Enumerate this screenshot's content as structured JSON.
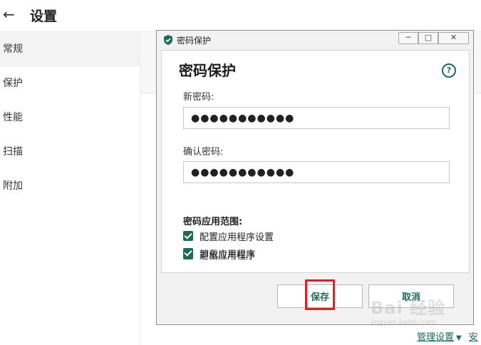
{
  "header": {
    "title": "设置",
    "back_glyph": "←"
  },
  "sidebar": {
    "items": [
      {
        "label": "常规",
        "active": true
      },
      {
        "label": "保护"
      },
      {
        "label": "性能"
      },
      {
        "label": "扫描"
      },
      {
        "label": "附加"
      }
    ]
  },
  "footer": {
    "manage_settings": "管理设置",
    "truncated_link": "安"
  },
  "dialog": {
    "caption": "密码保护",
    "heading": "密码保护",
    "help_glyph": "?",
    "new_password": {
      "label": "新密码:",
      "value": "●●●●●●●●●●●"
    },
    "confirm_password": {
      "label": "确认密码:",
      "value": "●●●●●●●●●●●"
    },
    "scope_title": "密码应用范围:",
    "scope_options": [
      {
        "label": "配置应用程序设置",
        "checked": true
      },
      {
        "label": "退出应用程序",
        "checked": true
      },
      {
        "label": "卸载应用程序",
        "checked": true
      }
    ],
    "save_label": "保存",
    "cancel_label": "取消"
  },
  "watermark": {
    "text": "Bai 经验",
    "sub": "jingyan.baidu.com"
  },
  "colors": {
    "accent": "#1a6b58",
    "highlight": "#e0201f"
  }
}
